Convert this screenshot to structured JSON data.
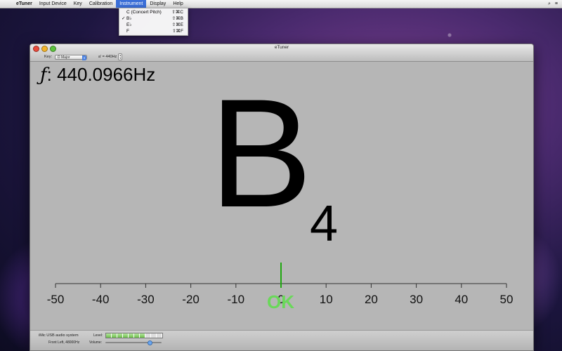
{
  "menubar": {
    "apple_icon": "apple-icon",
    "items": [
      "eTuner",
      "Input Device",
      "Key",
      "Calibration",
      "Instrument",
      "Display",
      "Help"
    ],
    "active": "Instrument"
  },
  "instrument_menu": [
    {
      "label": "C (Concert Pitch)",
      "shortcut": "⇧⌘C",
      "checked": false
    },
    {
      "label": "B♭",
      "shortcut": "⇧⌘B",
      "checked": true
    },
    {
      "label": "E♭",
      "shortcut": "⇧⌘E",
      "checked": false
    },
    {
      "label": "F",
      "shortcut": "⇧⌘F",
      "checked": false
    }
  ],
  "window": {
    "title": "eTuner",
    "key_label": "Key:",
    "key_value": "D Major",
    "ref_label": "a' = 440Hz"
  },
  "tuner": {
    "freq_symbol": "ƒ",
    "freq_value": ": 440.0966Hz",
    "note": "B",
    "octave": "4",
    "status": "OK",
    "cents_offset": 0,
    "scale_labels": [
      "-50",
      "-40",
      "-30",
      "-20",
      "-10",
      "0",
      "10",
      "20",
      "30",
      "40",
      "50"
    ],
    "scale_min": -50,
    "scale_max": 50,
    "indicator_color": "#1fa80f",
    "ok_color": "#6ad85a"
  },
  "status_bar": {
    "device": "iMic USB audio system",
    "channel": "Front Left, 48000Hz",
    "level_label": "Level:",
    "volume_label": "Volume:",
    "level_segments_total": 10,
    "level_segments_on": 7,
    "volume": 0.78
  }
}
